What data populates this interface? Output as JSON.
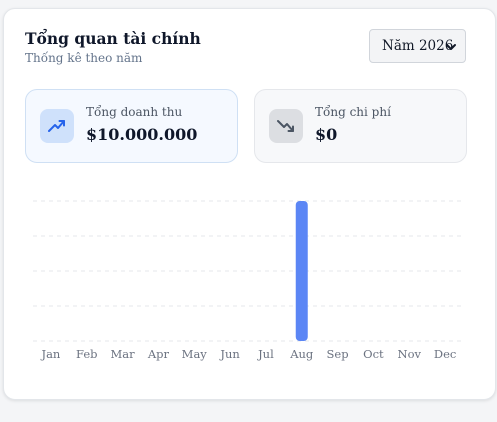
{
  "header": {
    "title": "Tổng quan tài chính",
    "subtitle": "Thống kê theo năm"
  },
  "year_select": {
    "value": "Năm 2026"
  },
  "stats": {
    "income": {
      "label": "Tổng doanh thu",
      "value": "$10.000.000",
      "icon": "trending-up-icon",
      "color": "#2563eb"
    },
    "expense": {
      "label": "Tổng chi phí",
      "value": "$0",
      "icon": "trending-down-icon",
      "color": "#4b5563"
    }
  },
  "chart_data": {
    "type": "bar",
    "categories": [
      "Jan",
      "Feb",
      "Mar",
      "Apr",
      "May",
      "Jun",
      "Jul",
      "Aug",
      "Sep",
      "Oct",
      "Nov",
      "Dec"
    ],
    "series": [
      {
        "values": [
          0,
          0,
          0,
          0,
          0,
          0,
          0,
          10000000,
          0,
          0,
          0,
          0
        ]
      }
    ],
    "ylim": [
      0,
      10000000
    ],
    "grid": true,
    "bar_color": "#5b86f5"
  }
}
